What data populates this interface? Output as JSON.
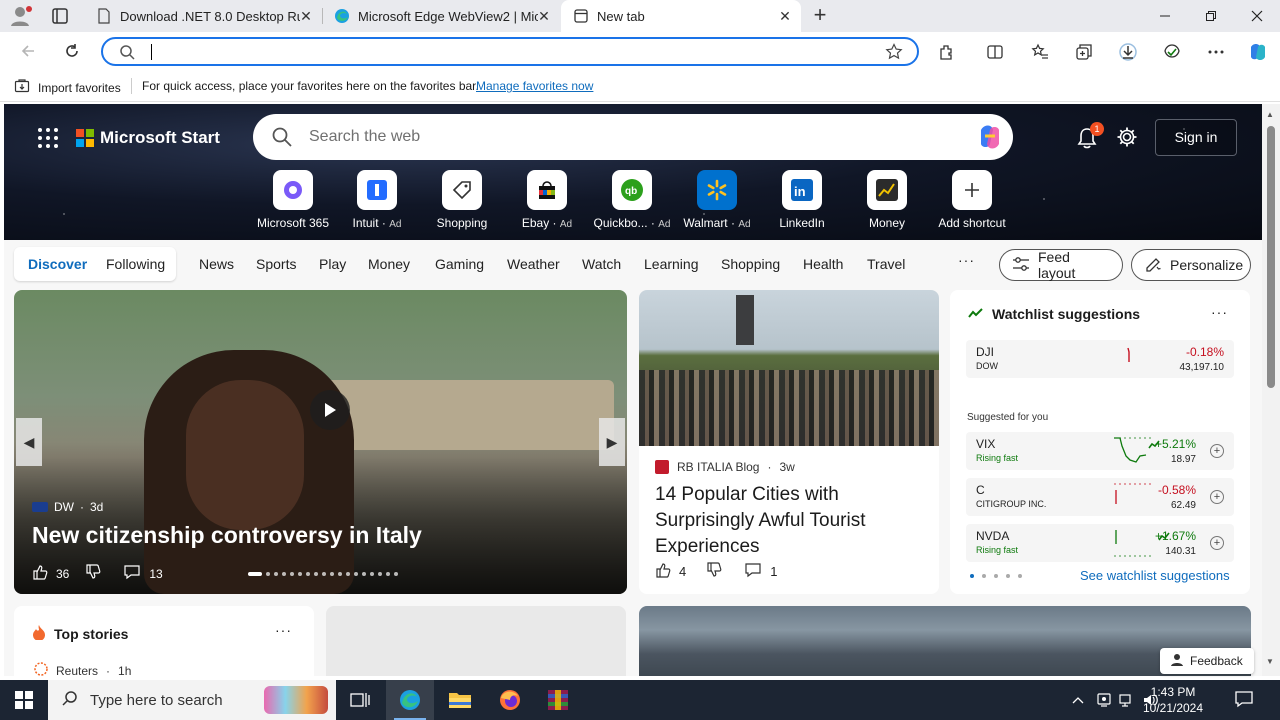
{
  "tabs": [
    {
      "title": "Download .NET 8.0 Desktop Runtime",
      "active": false
    },
    {
      "title": "Microsoft Edge WebView2 | Microsoft",
      "active": false
    },
    {
      "title": "New tab",
      "active": true
    }
  ],
  "favorites_bar": {
    "import_label": "Import favorites",
    "message": "For quick access, place your favorites here on the favorites bar.",
    "link": "Manage favorites now"
  },
  "header": {
    "brand": "Microsoft Start",
    "search_placeholder": "Search the web",
    "notification_count": "1",
    "sign_in": "Sign in"
  },
  "shortcuts": [
    {
      "label": "Microsoft 365",
      "ad": ""
    },
    {
      "label": "Intuit",
      "ad": "Ad"
    },
    {
      "label": "Shopping",
      "ad": ""
    },
    {
      "label": "Ebay",
      "ad": "Ad"
    },
    {
      "label": "Quickbo...",
      "ad": "Ad"
    },
    {
      "label": "Walmart",
      "ad": "Ad"
    },
    {
      "label": "LinkedIn",
      "ad": ""
    },
    {
      "label": "Money",
      "ad": ""
    },
    {
      "label": "Add shortcut",
      "ad": ""
    }
  ],
  "nav": {
    "discover": "Discover",
    "following": "Following",
    "items": [
      "News",
      "Sports",
      "Play",
      "Money",
      "Gaming",
      "Weather",
      "Watch",
      "Learning",
      "Shopping",
      "Health",
      "Travel"
    ],
    "more": "···",
    "feed_layout": "Feed layout",
    "personalize": "Personalize"
  },
  "main_story": {
    "source": "DW",
    "age": "3d",
    "title": "New citizenship controversy in Italy",
    "likes": "36",
    "comments": "13"
  },
  "city_story": {
    "source": "RB ITALIA Blog",
    "age": "3w",
    "title": "14 Popular Cities with Surprisingly Awful Tourist Experiences",
    "likes": "4",
    "comments": "1"
  },
  "watchlist": {
    "title": "Watchlist suggestions",
    "more": "···",
    "suggested_label": "Suggested for you",
    "link": "See watchlist suggestions",
    "stocks": [
      {
        "symbol": "DJI",
        "sub": "DOW",
        "change": "-0.18%",
        "value": "43,197.10",
        "positive": false,
        "badge": false
      },
      {
        "symbol": "VIX",
        "sub": "Rising fast",
        "change": "+5.21%",
        "value": "18.97",
        "positive": true,
        "badge": true
      },
      {
        "symbol": "C",
        "sub": "CITIGROUP INC.",
        "change": "-0.58%",
        "value": "62.49",
        "positive": false,
        "badge": false
      },
      {
        "symbol": "NVDA",
        "sub": "Rising fast",
        "change": "+1.67%",
        "value": "140.31",
        "positive": true,
        "badge": true
      }
    ]
  },
  "top_stories": {
    "title": "Top stories",
    "more": "···",
    "source": "Reuters",
    "age": "1h"
  },
  "feedback": "Feedback",
  "taskbar": {
    "search_placeholder": "Type here to search",
    "time": "1:43 PM",
    "date": "10/21/2024"
  },
  "colors": {
    "accent": "#0f6cbd",
    "negative": "#c50f1f",
    "positive": "#0e7a0d",
    "taskbar": "#1c2533"
  }
}
